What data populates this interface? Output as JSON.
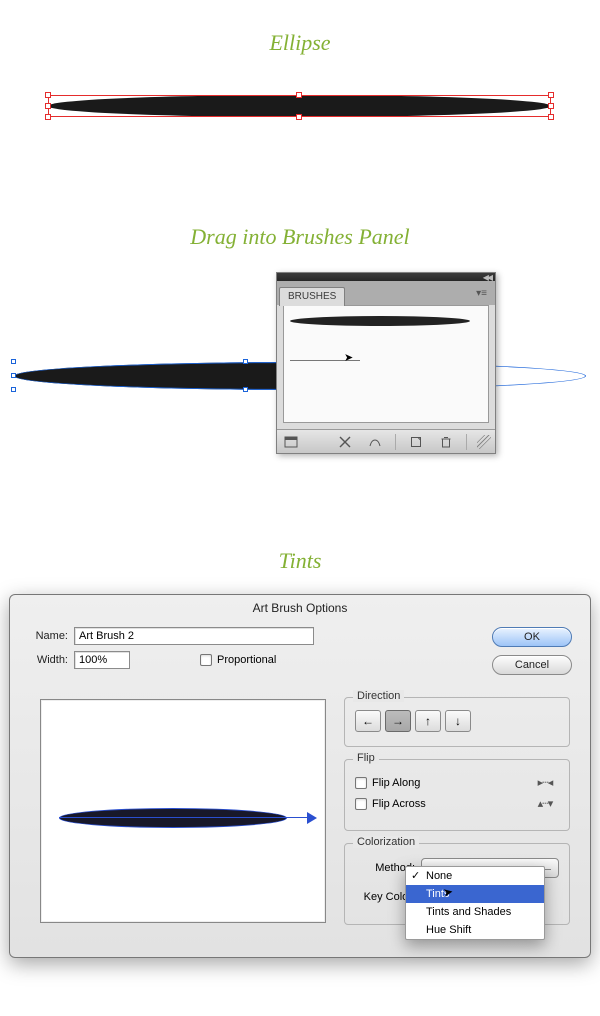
{
  "headings": {
    "ellipse": "Ellipse",
    "drag": "Drag into Brushes Panel",
    "tints": "Tints"
  },
  "brushes_panel": {
    "tab": "BRUSHES",
    "collapse_glyph": "◀◀",
    "menu_glyph": "▾≡",
    "footer": {
      "libraries": "libraries-icon",
      "strokeopts": "stroke-options-icon",
      "remove": "remove-brush-stroke-icon",
      "new": "new-brush-icon",
      "trash": "delete-brush-icon"
    }
  },
  "dialog": {
    "title": "Art Brush Options",
    "name_label": "Name:",
    "name_value": "Art Brush 2",
    "width_label": "Width:",
    "width_value": "100%",
    "proportional_label": "Proportional",
    "ok": "OK",
    "cancel": "Cancel",
    "direction": {
      "legend": "Direction",
      "left": "←",
      "right": "→",
      "up": "↑",
      "down": "↓"
    },
    "flip": {
      "legend": "Flip",
      "along": "Flip Along",
      "across": "Flip Across",
      "along_glyph": "▸┄◂",
      "across_glyph": "▴┄▾"
    },
    "colorization": {
      "legend": "Colorization",
      "method_label": "Method:",
      "keycolor_label": "Key Color:",
      "menu": {
        "none": "None",
        "tints": "Tints",
        "tints_shades": "Tints and Shades",
        "hue_shift": "Hue Shift"
      }
    }
  }
}
